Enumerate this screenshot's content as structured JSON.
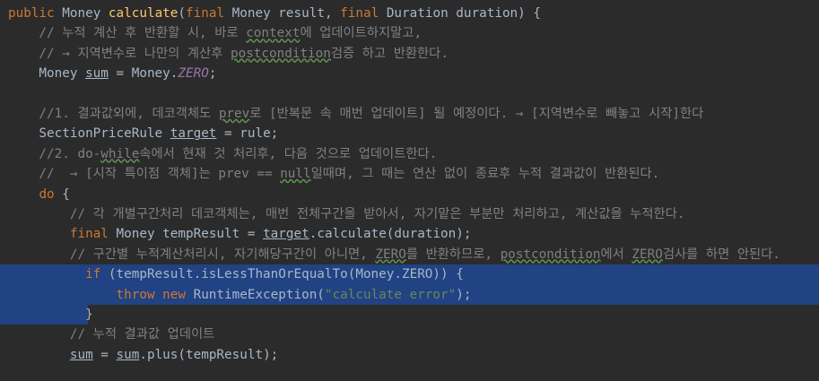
{
  "lines": [
    {
      "text": "public Money calculate(final Money result, final Duration duration) {"
    },
    {
      "text": "    // 누적 계산 후 반환할 시, 바로 context에 업데이트하지말고,"
    },
    {
      "text": "    // → 지역변수로 나만의 계산후 postcondition검증 하고 반환한다."
    },
    {
      "text": "    Money sum = Money.ZERO;"
    },
    {
      "text": ""
    },
    {
      "text": "    //1. 결과값외에, 데코객체도 prev로 [반복문 속 매번 업데이트] 될 예정이다. → [지역변수로 빼놓고 시작]한다"
    },
    {
      "text": "    SectionPriceRule target = rule;"
    },
    {
      "text": "    //2. do-while속에서 현재 것 처리후, 다음 것으로 업데이트한다."
    },
    {
      "text": "    //  → [시작 특이점 객체]는 prev == null일때며, 그 때는 연산 없이 종료후 누적 결과값이 반환된다."
    },
    {
      "text": "    do {"
    },
    {
      "text": "        // 각 개별구간처리 데코객체는, 매번 전체구간을 받아서, 자기맡은 부분만 처리하고, 계산값을 누적한다."
    },
    {
      "text": "        final Money tempResult = target.calculate(duration);"
    },
    {
      "text": "        // 구간별 누적계산처리시, 자기해당구간이 아니면, ZERO를 반환하므로, postcondition에서 ZERO검사를 하면 안된다."
    },
    {
      "text": "          if (tempResult.isLessThanOrEqualTo(Money.ZERO)) {"
    },
    {
      "text": "              throw new RuntimeException(\"calculate error\");"
    },
    {
      "text": "          }"
    },
    {
      "text": "        // 누적 결과값 업데이트"
    },
    {
      "text": "        sum = sum.plus(tempResult);"
    }
  ],
  "colors": {
    "background": "#2b2b2b",
    "selection": "#214283",
    "keyword": "#cc7832",
    "method": "#ffc66d",
    "comment": "#808080",
    "string": "#6a8759",
    "static_field": "#9876aa",
    "text": "#a9b7c6"
  }
}
